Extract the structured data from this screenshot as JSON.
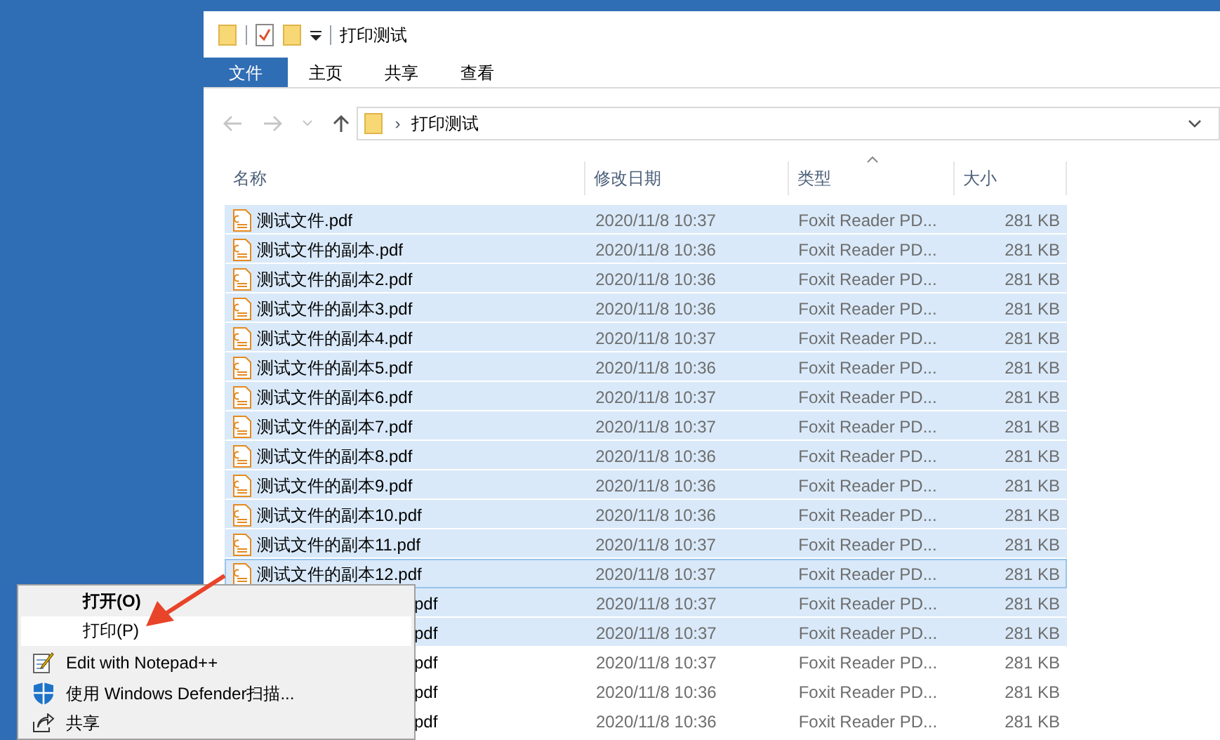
{
  "window": {
    "title": "打印测试"
  },
  "ribbon_tabs": [
    {
      "label": "文件",
      "selected": true
    },
    {
      "label": "主页",
      "selected": false
    },
    {
      "label": "共享",
      "selected": false
    },
    {
      "label": "查看",
      "selected": false
    }
  ],
  "address_bar": {
    "path": "打印测试",
    "separator": "›"
  },
  "columns": [
    "名称",
    "修改日期",
    "类型",
    "大小"
  ],
  "rows": [
    {
      "name": "测试文件.pdf",
      "date": "2020/11/8 10:37",
      "type": "Foxit Reader PD...",
      "size": "281 KB",
      "selected": true,
      "focused": false
    },
    {
      "name": "测试文件的副本.pdf",
      "date": "2020/11/8 10:36",
      "type": "Foxit Reader PD...",
      "size": "281 KB",
      "selected": true,
      "focused": false
    },
    {
      "name": "测试文件的副本2.pdf",
      "date": "2020/11/8 10:36",
      "type": "Foxit Reader PD...",
      "size": "281 KB",
      "selected": true,
      "focused": false
    },
    {
      "name": "测试文件的副本3.pdf",
      "date": "2020/11/8 10:36",
      "type": "Foxit Reader PD...",
      "size": "281 KB",
      "selected": true,
      "focused": false
    },
    {
      "name": "测试文件的副本4.pdf",
      "date": "2020/11/8 10:37",
      "type": "Foxit Reader PD...",
      "size": "281 KB",
      "selected": true,
      "focused": false
    },
    {
      "name": "测试文件的副本5.pdf",
      "date": "2020/11/8 10:36",
      "type": "Foxit Reader PD...",
      "size": "281 KB",
      "selected": true,
      "focused": false
    },
    {
      "name": "测试文件的副本6.pdf",
      "date": "2020/11/8 10:37",
      "type": "Foxit Reader PD...",
      "size": "281 KB",
      "selected": true,
      "focused": false
    },
    {
      "name": "测试文件的副本7.pdf",
      "date": "2020/11/8 10:37",
      "type": "Foxit Reader PD...",
      "size": "281 KB",
      "selected": true,
      "focused": false
    },
    {
      "name": "测试文件的副本8.pdf",
      "date": "2020/11/8 10:36",
      "type": "Foxit Reader PD...",
      "size": "281 KB",
      "selected": true,
      "focused": false
    },
    {
      "name": "测试文件的副本9.pdf",
      "date": "2020/11/8 10:36",
      "type": "Foxit Reader PD...",
      "size": "281 KB",
      "selected": true,
      "focused": false
    },
    {
      "name": "测试文件的副本10.pdf",
      "date": "2020/11/8 10:36",
      "type": "Foxit Reader PD...",
      "size": "281 KB",
      "selected": true,
      "focused": false
    },
    {
      "name": "测试文件的副本11.pdf",
      "date": "2020/11/8 10:37",
      "type": "Foxit Reader PD...",
      "size": "281 KB",
      "selected": true,
      "focused": false
    },
    {
      "name": "测试文件的副本12.pdf",
      "date": "2020/11/8 10:37",
      "type": "Foxit Reader PD...",
      "size": "281 KB",
      "selected": true,
      "focused": true
    },
    {
      "name": "pdf",
      "name_clipped": true,
      "date": "2020/11/8 10:37",
      "type": "Foxit Reader PD...",
      "size": "281 KB",
      "selected": true,
      "focused": false
    },
    {
      "name": "pdf",
      "name_clipped": true,
      "date": "2020/11/8 10:37",
      "type": "Foxit Reader PD...",
      "size": "281 KB",
      "selected": true,
      "focused": false
    },
    {
      "name": "pdf",
      "name_clipped": true,
      "date": "2020/11/8 10:37",
      "type": "Foxit Reader PD...",
      "size": "281 KB",
      "selected": false,
      "focused": false
    },
    {
      "name": "pdf",
      "name_clipped": true,
      "date": "2020/11/8 10:36",
      "type": "Foxit Reader PD...",
      "size": "281 KB",
      "selected": false,
      "focused": false
    },
    {
      "name": "pdf",
      "name_clipped": true,
      "date": "2020/11/8 10:36",
      "type": "Foxit Reader PD...",
      "size": "281 KB",
      "selected": false,
      "focused": false
    }
  ],
  "context_menu": [
    {
      "label": "打开(O)",
      "kind": "default",
      "selected": false
    },
    {
      "label": "打印(P)",
      "kind": "plain",
      "selected": true
    },
    {
      "label": "Edit with Notepad++",
      "kind": "notepad",
      "selected": false
    },
    {
      "label": "使用 Windows Defender扫描...",
      "kind": "shield",
      "selected": false
    },
    {
      "label": "共享",
      "kind": "share",
      "selected": false
    }
  ]
}
